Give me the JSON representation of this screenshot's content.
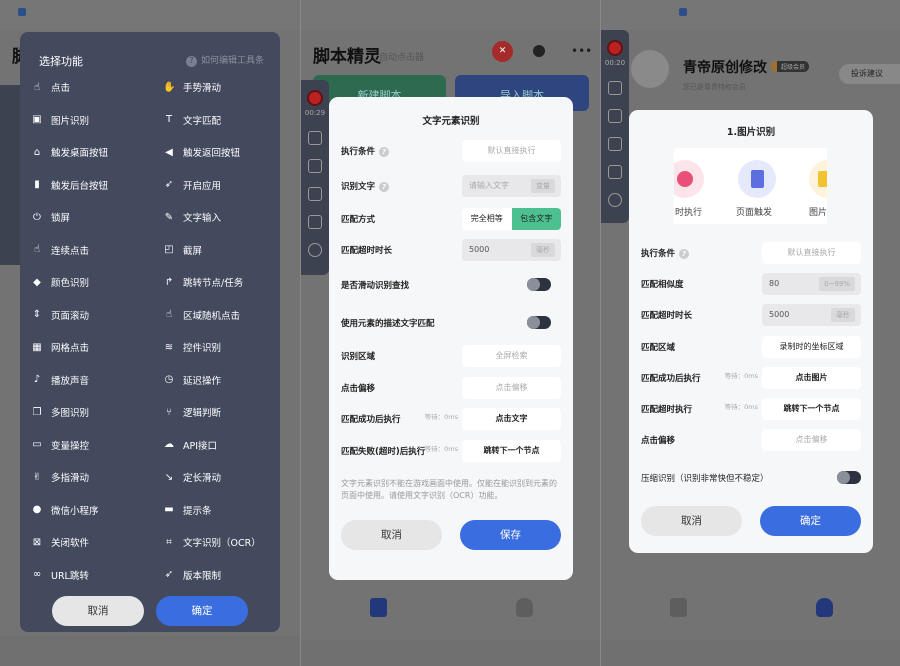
{
  "panel1": {
    "bg_title": "脚",
    "modal_title": "选择功能",
    "help_link": "如何编辑工具条",
    "items": [
      {
        "label": "点击",
        "icon": "tap-icon",
        "glyph": "☝"
      },
      {
        "label": "手势滑动",
        "icon": "gesture-icon",
        "glyph": "✋"
      },
      {
        "label": "图片识别",
        "icon": "image-scan-icon",
        "glyph": "▣"
      },
      {
        "label": "文字匹配",
        "icon": "text-match-icon",
        "glyph": "T"
      },
      {
        "label": "触发桌面按钮",
        "icon": "home-icon",
        "glyph": "⌂"
      },
      {
        "label": "触发返回按钮",
        "icon": "back-icon",
        "glyph": "◀"
      },
      {
        "label": "触发后台按钮",
        "icon": "recents-icon",
        "glyph": "▮"
      },
      {
        "label": "开启应用",
        "icon": "rocket-icon",
        "glyph": "➶"
      },
      {
        "label": "锁屏",
        "icon": "power-icon",
        "glyph": "⏻"
      },
      {
        "label": "文字输入",
        "icon": "text-input-icon",
        "glyph": "✎"
      },
      {
        "label": "连续点击",
        "icon": "multi-tap-icon",
        "glyph": "☝"
      },
      {
        "label": "截屏",
        "icon": "screenshot-icon",
        "glyph": "◰"
      },
      {
        "label": "颜色识别",
        "icon": "paint-bucket-icon",
        "glyph": "◆"
      },
      {
        "label": "跳转节点/任务",
        "icon": "jump-icon",
        "glyph": "↱"
      },
      {
        "label": "页面滚动",
        "icon": "scroll-icon",
        "glyph": "⇕"
      },
      {
        "label": "区域随机点击",
        "icon": "random-tap-icon",
        "glyph": "☝"
      },
      {
        "label": "网格点击",
        "icon": "grid-tap-icon",
        "glyph": "▦"
      },
      {
        "label": "控件识别",
        "icon": "layers-icon",
        "glyph": "≋"
      },
      {
        "label": "播放声音",
        "icon": "bell-icon",
        "glyph": "♪"
      },
      {
        "label": "延迟操作",
        "icon": "clock-icon",
        "glyph": "◷"
      },
      {
        "label": "多图识别",
        "icon": "multi-image-icon",
        "glyph": "❐"
      },
      {
        "label": "逻辑判断",
        "icon": "logic-icon",
        "glyph": "⑂"
      },
      {
        "label": "变量操控",
        "icon": "variable-icon",
        "glyph": "▭"
      },
      {
        "label": "API接口",
        "icon": "cloud-icon",
        "glyph": "☁"
      },
      {
        "label": "多指滑动",
        "icon": "multi-finger-icon",
        "glyph": "✌"
      },
      {
        "label": "定长滑动",
        "icon": "swipe-path-icon",
        "glyph": "↘"
      },
      {
        "label": "微信小程序",
        "icon": "miniprogram-icon",
        "glyph": "●"
      },
      {
        "label": "提示条",
        "icon": "tip-icon",
        "glyph": "▬"
      },
      {
        "label": "关闭软件",
        "icon": "close-app-icon",
        "glyph": "⊠"
      },
      {
        "label": "文字识别（OCR）",
        "icon": "ocr-icon",
        "glyph": "⌗"
      },
      {
        "label": "URL跳转",
        "icon": "link-icon",
        "glyph": "∞"
      },
      {
        "label": "版本限制",
        "icon": "rocket-icon",
        "glyph": "➶"
      }
    ],
    "cancel": "取消",
    "confirm": "确定"
  },
  "panel2": {
    "app_title": "脚本精灵",
    "app_subtitle": "自动点击器",
    "new_script": "新建脚本",
    "import_script": "导入脚本",
    "timer": "00:29",
    "modal_title": "文字元素识别",
    "rows": {
      "condition": {
        "label": "执行条件",
        "value": "默认直接执行"
      },
      "text": {
        "label": "识别文字",
        "placeholder": "请输入文字",
        "unit": "变量"
      },
      "mode": {
        "label": "匹配方式",
        "options": [
          "完全相等",
          "包含文字"
        ],
        "selected": "包含文字"
      },
      "timeout": {
        "label": "匹配超时时长",
        "value": "5000",
        "unit": "毫秒"
      },
      "scroll": {
        "label": "是否滑动识别查找",
        "on": false
      },
      "desc": {
        "label": "使用元素的描述文字匹配",
        "on": false
      },
      "area": {
        "label": "识别区域",
        "value": "全屏检索"
      },
      "offset": {
        "label": "点击偏移",
        "value": "点击偏移"
      },
      "success": {
        "label": "匹配成功后执行",
        "wait": "等待：0ms",
        "value": "点击文字"
      },
      "fail": {
        "label": "匹配失败(超时)后执行",
        "wait": "等待：0ms",
        "value": "跳转下一个节点"
      }
    },
    "note": "文字元素识别不能在游戏画面中使用。仅能在能识别到元素的页面中使用。请使用文字识别（OCR）功能。",
    "cancel": "取消",
    "save": "保存"
  },
  "panel3": {
    "username": "青帝原创修改",
    "badge": "超级会员",
    "member_text": "您已是尊贵特权会员",
    "feedback": "投诉建议",
    "timer": "00:20",
    "modal_title": "1.图片识别",
    "triggers": [
      {
        "label": "时执行",
        "color": "#e8507a"
      },
      {
        "label": "页面触发",
        "color": "#5b6fe0"
      },
      {
        "label": "图片",
        "color": "#f2c230"
      }
    ],
    "rows": {
      "condition": {
        "label": "执行条件",
        "value": "默认直接执行"
      },
      "similarity": {
        "label": "匹配相似度",
        "value": "80",
        "unit": "0~99%"
      },
      "timeout": {
        "label": "匹配超时时长",
        "value": "5000",
        "unit": "毫秒"
      },
      "area": {
        "label": "匹配区域",
        "value": "录制时的坐标区域"
      },
      "success": {
        "label": "匹配成功后执行",
        "wait": "等待：0ms",
        "value": "点击图片"
      },
      "fail": {
        "label": "匹配超时执行",
        "wait": "等待：0ms",
        "value": "跳转下一个节点"
      },
      "offset": {
        "label": "点击偏移",
        "value": "点击偏移"
      },
      "compress": {
        "label": "压缩识别（识别非常快但不稳定）",
        "on": false
      }
    },
    "cancel": "取消",
    "confirm": "确定"
  },
  "colors": {
    "accent": "#3a6ee0",
    "green": "#4cc18f",
    "modal_dark": "#434a5e"
  }
}
